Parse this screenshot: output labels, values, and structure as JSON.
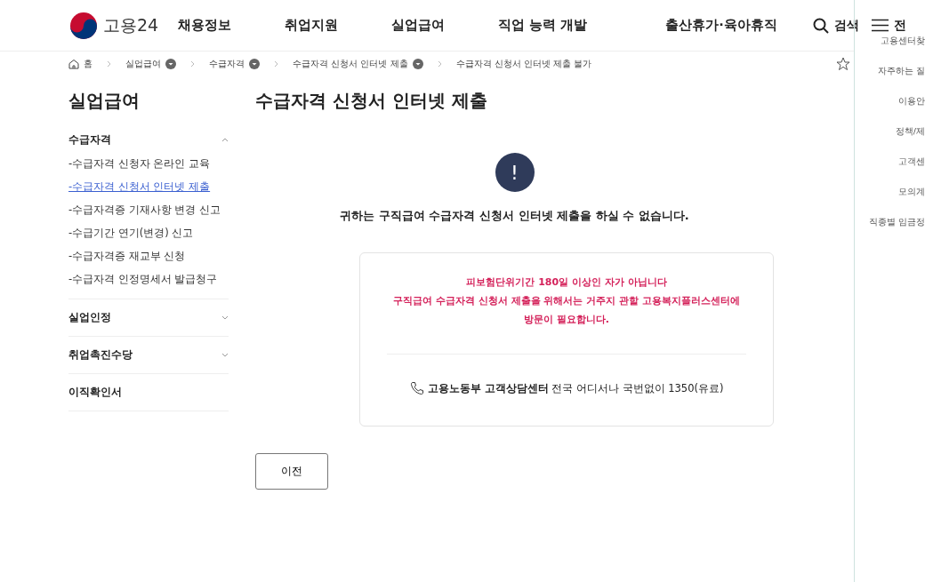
{
  "header": {
    "logo_text": "고용24",
    "nav": [
      "채용정보",
      "취업지원",
      "실업급여",
      "직업 능력 개발",
      "출산휴가·육아휴직"
    ],
    "search_label": "검색",
    "menu_label": "전"
  },
  "breadcrumb": [
    {
      "kind": "home",
      "label": "홈"
    },
    {
      "kind": "dropdown",
      "label": "실업급여"
    },
    {
      "kind": "dropdown",
      "label": "수급자격"
    },
    {
      "kind": "dropdown",
      "label": "수급자격 신청서 인터넷 제출"
    },
    {
      "kind": "plain",
      "label": "수급자격 신청서 인터넷 제출 불가"
    }
  ],
  "sidebar": {
    "title": "실업급여",
    "sections": [
      {
        "kind": "group",
        "label": "수급자격",
        "expanded": true,
        "children": [
          {
            "label": "-수급자격 신청자 온라인 교육",
            "selected": false
          },
          {
            "label": "-수급자격 신청서 인터넷 제출",
            "selected": true
          },
          {
            "label": "-수급자격증 기재사항 변경 신고",
            "selected": false
          },
          {
            "label": "-수급기간 연기(변경) 신고",
            "selected": false
          },
          {
            "label": "-수급자격증 재교부 신청",
            "selected": false
          },
          {
            "label": "-수급자격 인정명세서 발급청구",
            "selected": false
          }
        ]
      },
      {
        "kind": "group",
        "label": "실업인정",
        "expanded": false
      },
      {
        "kind": "group",
        "label": "취업촉진수당",
        "expanded": false
      },
      {
        "kind": "link",
        "label": "이직확인서"
      }
    ]
  },
  "page_title": "수급자격 신청서 인터넷 제출",
  "alert": {
    "icon_text": "!",
    "message": "귀하는 구직급여 수급자격 신청서 인터넷 제출을 하실 수 없습니다."
  },
  "card": {
    "notice": [
      "피보험단위기간 180일 이상인 자가 아닙니다",
      "구직급여 수급자격 신청서 제출을 위해서는 거주지 관할 고용복지플러스센터에 방문이 필요합니다."
    ],
    "contact": "**고용노동부 고객상담센터** 전국 어디서나 국번없이 1350(유료)"
  },
  "back_button": "이전",
  "quick_menu": [
    "고용센터찾",
    "자주하는 질",
    "이용안",
    "정책/제",
    "고객센",
    "모의계",
    "직종별 임금정"
  ]
}
